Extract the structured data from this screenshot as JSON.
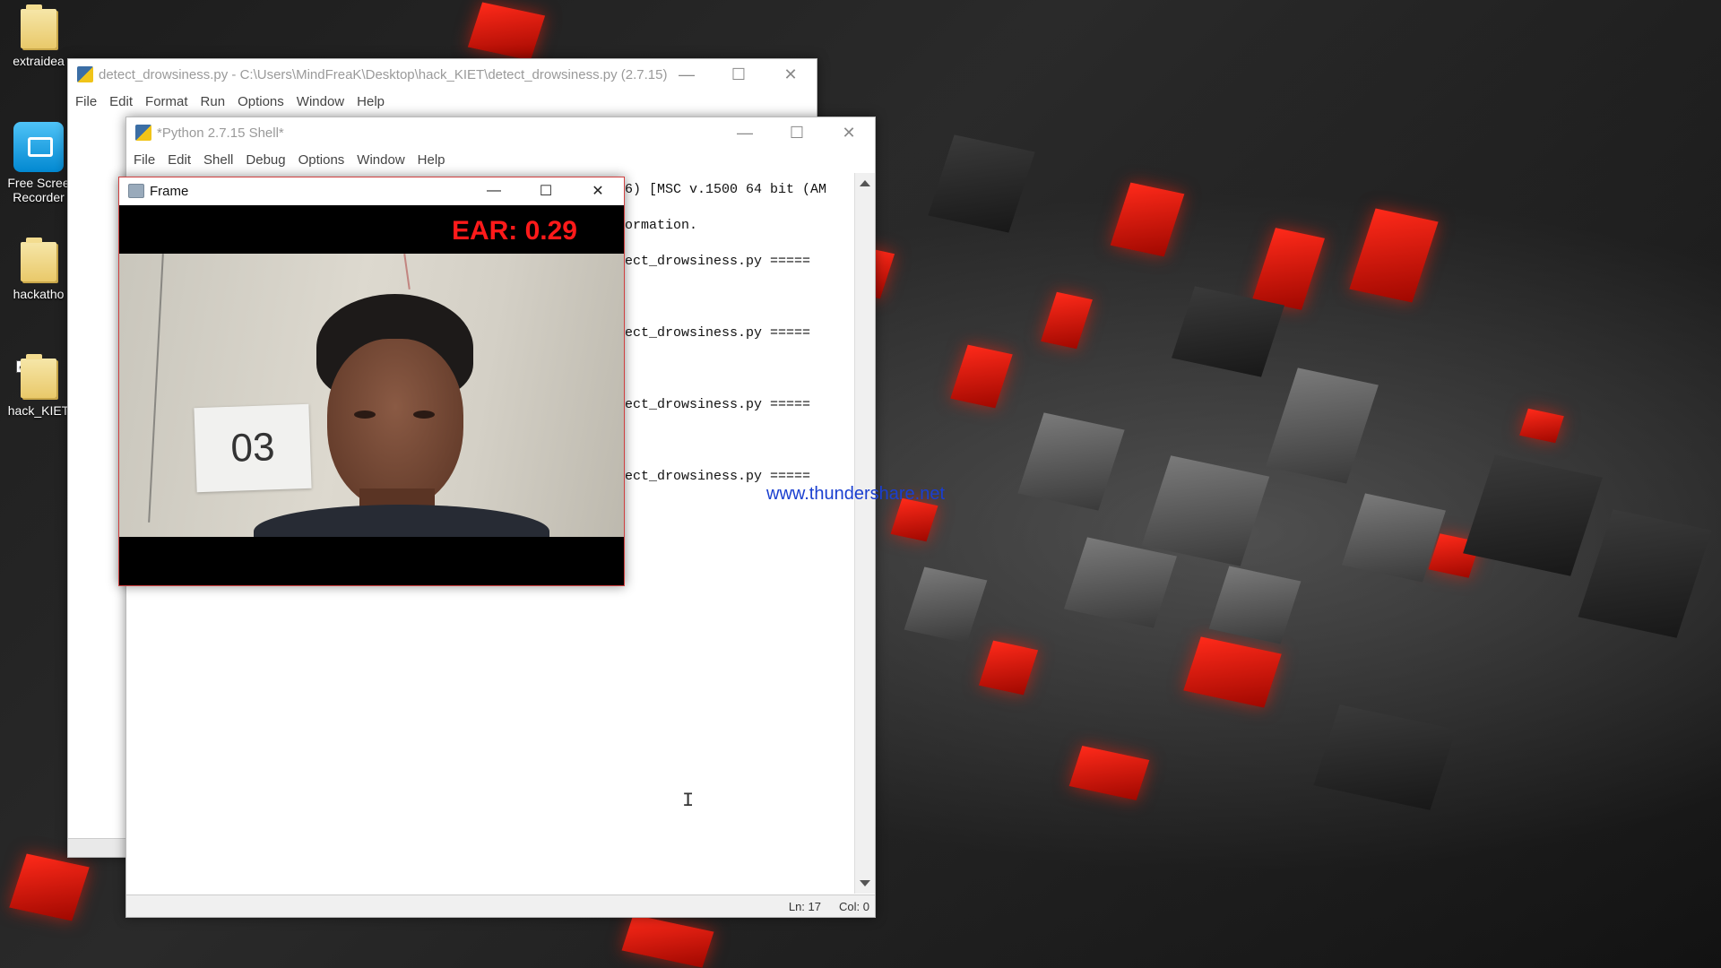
{
  "desktop": {
    "icons": [
      {
        "label": "extraidea",
        "type": "folder"
      },
      {
        "label": "Free Screen Recorder",
        "line1": "Free Scree",
        "line2": "Recorder",
        "type": "app"
      },
      {
        "label": "hackathon",
        "display": "hackatho",
        "type": "folder"
      },
      {
        "label": "hack_KIET",
        "display": "hack_KIET",
        "type": "folder",
        "checked": true
      }
    ]
  },
  "editor": {
    "title": "detect_drowsiness.py - C:\\Users\\MindFreaK\\Desktop\\hack_KIET\\detect_drowsiness.py (2.7.15)",
    "menu": [
      "File",
      "Edit",
      "Format",
      "Run",
      "Options",
      "Window",
      "Help"
    ]
  },
  "shell": {
    "title": "*Python 2.7.15 Shell*",
    "menu": [
      "File",
      "Edit",
      "Shell",
      "Debug",
      "Options",
      "Window",
      "Help"
    ],
    "lines": [
      "6) [MSC v.1500 64 bit (AM",
      "ormation.",
      "ect_drowsiness.py =====",
      "ect_drowsiness.py =====",
      "ect_drowsiness.py =====",
      "ect_drowsiness.py ====="
    ],
    "status": {
      "ln": "Ln: 17",
      "col": "Col: 0"
    }
  },
  "frame": {
    "title": "Frame",
    "ear_label": "EAR: 0.29",
    "ear_value": 0.29,
    "sign_text": "03"
  },
  "watermark": "www.thundershare.net",
  "caption_glyphs": {
    "minimize": "—",
    "maximize": "☐",
    "close": "✕"
  },
  "colors": {
    "ear_text": "#ff1a1a",
    "watermark": "#1a3fd0",
    "wallpaper_accent": "#ff2a1a"
  }
}
